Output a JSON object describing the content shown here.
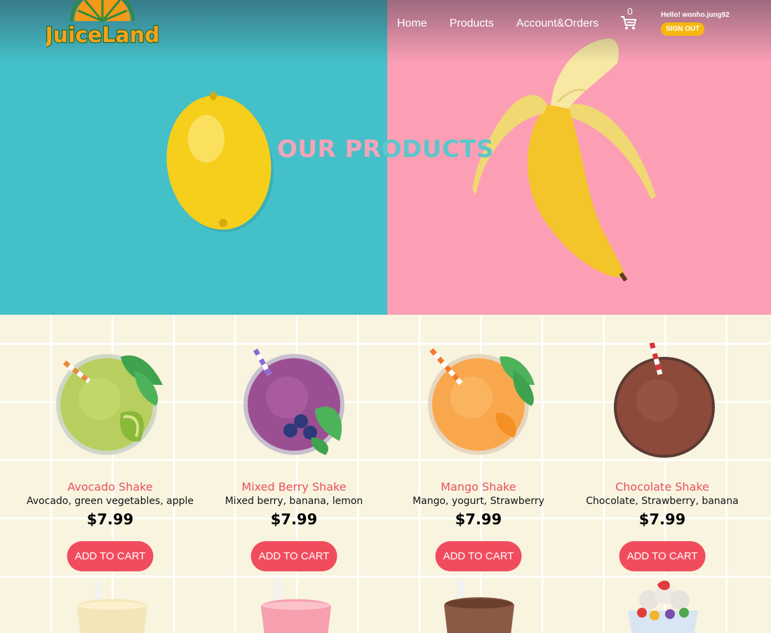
{
  "header": {
    "logo_text": "JuiceLand",
    "nav": [
      {
        "label": "Home"
      },
      {
        "label": "Products"
      },
      {
        "label": "Account&Orders"
      }
    ],
    "cart_count": "0",
    "greeting": "Hello! wonho.jung92",
    "signout_label": "SIGN OUT"
  },
  "hero": {
    "title_left": "OUR PR",
    "title_right": "ODUCTS",
    "left_color": "#44c0c8",
    "right_color": "#fc9fb5"
  },
  "products": [
    {
      "name": "Avocado Shake",
      "desc": "Avocado, green vegetables, apple",
      "price": "$7.99",
      "button": "ADD TO CART",
      "color": "#b8cf5f"
    },
    {
      "name": "Mixed Berry Shake",
      "desc": "Mixed berry, banana, lemon",
      "price": "$7.99",
      "button": "ADD TO CART",
      "color": "#9b4f93"
    },
    {
      "name": "Mango Shake",
      "desc": "Mango, yogurt, Strawberry",
      "price": "$7.99",
      "button": "ADD TO CART",
      "color": "#f9a74d"
    },
    {
      "name": "Chocolate Shake",
      "desc": "Chocolate, Strawberry, banana",
      "price": "$7.99",
      "button": "ADD TO CART",
      "color": "#8c4a3b"
    }
  ],
  "colors": {
    "accent": "#f14c5e",
    "name": "#e9505e",
    "signout": "#f6b80f"
  }
}
